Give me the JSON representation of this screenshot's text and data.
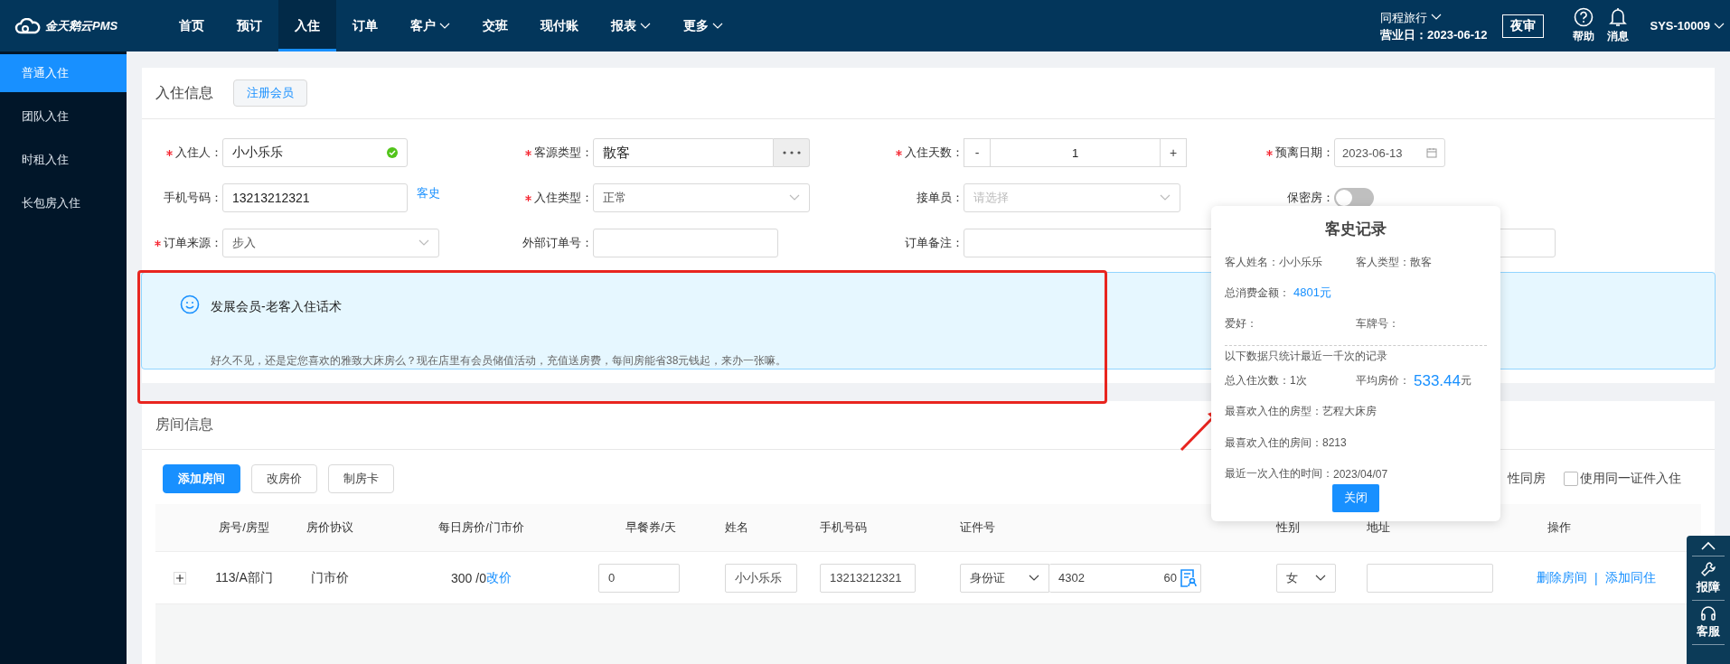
{
  "brand": {
    "name": "金天鹅云PMS"
  },
  "nav": [
    {
      "label": "首页",
      "selected": false,
      "dropdown": false
    },
    {
      "label": "预订",
      "selected": false,
      "dropdown": false
    },
    {
      "label": "入住",
      "selected": true,
      "dropdown": false
    },
    {
      "label": "订单",
      "selected": false,
      "dropdown": false
    },
    {
      "label": "客户",
      "selected": false,
      "dropdown": true
    },
    {
      "label": "交班",
      "selected": false,
      "dropdown": false
    },
    {
      "label": "现付账",
      "selected": false,
      "dropdown": false
    },
    {
      "label": "报表",
      "selected": false,
      "dropdown": true
    },
    {
      "label": "更多",
      "selected": false,
      "dropdown": true
    }
  ],
  "header_right": {
    "agency": "同程旅行",
    "business_date": "营业日：2023-06-12",
    "night_audit": "夜审",
    "tools": [
      {
        "label": "帮助"
      },
      {
        "label": "消息"
      }
    ],
    "user": "SYS-10009"
  },
  "sidebar": [
    {
      "label": "普通入住",
      "selected": true
    },
    {
      "label": "团队入住",
      "selected": false
    },
    {
      "label": "时租入住",
      "selected": false
    },
    {
      "label": "长包房入住",
      "selected": false
    }
  ],
  "checkin": {
    "title": "入住信息",
    "register_button": "注册会员",
    "fields": [
      {
        "kind": "text",
        "label": "入住人：",
        "required": true,
        "value": "小小乐乐",
        "valid": true
      },
      {
        "kind": "picker",
        "label": "客源类型：",
        "required": true,
        "value": "散客"
      },
      {
        "kind": "stepper",
        "label": "入住天数：",
        "required": true,
        "value": "1",
        "minus": "-",
        "plus": "+"
      },
      {
        "kind": "date",
        "label": "预离日期：",
        "required": true,
        "value": "2023-06-13"
      },
      {
        "kind": "text",
        "label": "手机号码：",
        "required": false,
        "value": "13213212321",
        "valid": false,
        "link": "客史"
      },
      {
        "kind": "select",
        "label": "入住类型：",
        "required": true,
        "value": "正常"
      },
      {
        "kind": "select",
        "label": "接单员：",
        "required": false,
        "placeholder": "请选择"
      },
      {
        "kind": "toggle",
        "label": "保密房：",
        "required": false,
        "on": false
      },
      {
        "kind": "select",
        "label": "订单来源：",
        "required": true,
        "value": "步入"
      },
      {
        "kind": "text",
        "label": "外部订单号：",
        "required": false,
        "valid": false
      },
      {
        "kind": "note",
        "label": "订单备注：",
        "required": false
      }
    ],
    "alert": {
      "title": "发展会员-老客入住话术",
      "message": "好久不见，还是定您喜欢的雅致大床房么？现在店里有会员储值活动，充值送房费，每间房能省38元钱起，来办一张嘛。"
    }
  },
  "rooms": {
    "title": "房间信息",
    "buttons": [
      {
        "label": "添加房间",
        "primary": true
      },
      {
        "label": "改房价",
        "primary": false
      },
      {
        "label": "制房卡",
        "primary": false
      }
    ],
    "option_fragment": "性同房",
    "options": [
      {
        "label": "使用同一证件入住",
        "checked": false
      }
    ],
    "columns": [
      "房号/房型",
      "房价协议",
      "每日房价/门市价",
      "早餐券/天",
      "姓名",
      "手机号码",
      "证件号",
      "性别",
      "地址",
      "操作"
    ],
    "rows": [
      {
        "expanded": false,
        "room": "113/A部门",
        "protocol": "门市价",
        "price": "300 /0",
        "price_link": "改价",
        "breakfast": "0",
        "name": "小小乐乐",
        "phone": "13213212321",
        "id_type": "身份证",
        "id_start": "4302",
        "id_end": "60",
        "gender": "女",
        "actions": [
          "删除房间",
          "添加同住"
        ],
        "action_separator": "|"
      }
    ]
  },
  "history": {
    "title": "客史记录",
    "rows_before": [
      [
        {
          "label": "客人姓名：",
          "value": "小小乐乐",
          "highlight": false
        },
        {
          "label": "客人类型：",
          "value": "散客",
          "highlight": false
        }
      ],
      [
        {
          "label": "总消费金额：",
          "value": "4801元",
          "highlight": true
        }
      ],
      [
        {
          "label": "爱好："
        },
        {
          "label": "车牌号："
        }
      ]
    ],
    "note": "以下数据只统计最近一千次的记录",
    "rows_after": [
      [
        {
          "label": "总入住次数：",
          "value": "1次",
          "highlight": false
        },
        {
          "label": "平均房价：",
          "value": "533.44",
          "unit": "元",
          "highlight": true
        }
      ],
      [
        {
          "label": "最喜欢入住的房型：",
          "value": "艺程大床房",
          "highlight": false
        }
      ],
      [
        {
          "label": "最喜欢入住的房间：",
          "value": "8213",
          "highlight": false
        }
      ],
      [
        {
          "label": "最近一次入住的时间：",
          "value": "2023/04/07",
          "highlight": false
        }
      ]
    ],
    "close_button": "关闭"
  },
  "side_tools": [
    {
      "label": "报障"
    },
    {
      "label": "客服"
    }
  ]
}
